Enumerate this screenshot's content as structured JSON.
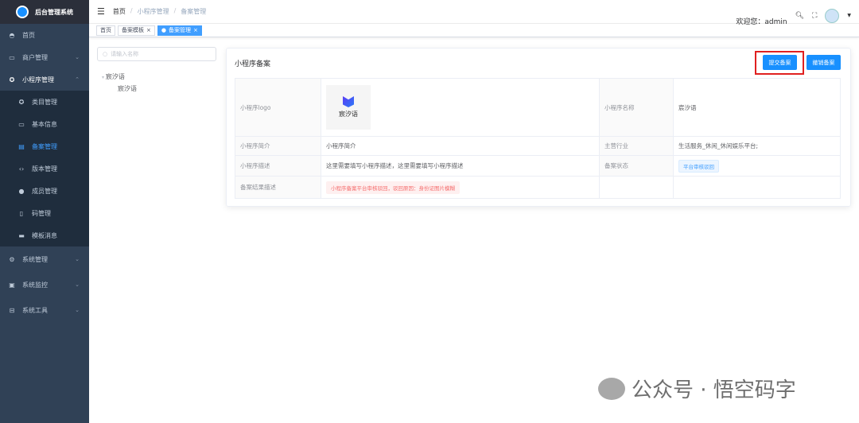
{
  "app": {
    "title": "后台管理系统"
  },
  "sidebar": {
    "items": [
      {
        "label": "首页",
        "icon": "dashboard-icon"
      },
      {
        "label": "商户管理",
        "icon": "merchant-icon"
      },
      {
        "label": "小程序管理",
        "icon": "miniprogram-icon",
        "children": [
          {
            "label": "类目管理"
          },
          {
            "label": "基本信息"
          },
          {
            "label": "备案管理",
            "active": true
          },
          {
            "label": "版本管理"
          },
          {
            "label": "成员管理"
          },
          {
            "label": "码管理"
          },
          {
            "label": "模板消息"
          }
        ]
      },
      {
        "label": "系统管理",
        "icon": "gear-icon"
      },
      {
        "label": "系统监控",
        "icon": "monitor-icon"
      },
      {
        "label": "系统工具",
        "icon": "toolbox-icon"
      }
    ]
  },
  "header": {
    "breadcrumb": [
      "首页",
      "小程序管理",
      "备案管理"
    ],
    "welcome": "欢迎您：admin"
  },
  "tabs": [
    {
      "label": "首页"
    },
    {
      "label": "备案模板"
    },
    {
      "label": "备案管理",
      "active": true
    }
  ],
  "tree": {
    "placeholder": "请输入名称",
    "root": "宸汐语",
    "child": "宸汐语"
  },
  "card": {
    "title": "小程序备案",
    "submit": "提交备案",
    "revoke": "撤销备案",
    "labels": {
      "logo": "小程序logo",
      "name": "小程序名称",
      "intro": "小程序简介",
      "industry": "主营行业",
      "desc": "小程序描述",
      "status": "备案状态",
      "result": "备案结果描述"
    },
    "values": {
      "logo_text": "宸汐语",
      "name": "宸汐语",
      "intro": "小程序简介",
      "industry": "生活服务_休闲_休闲娱乐平台;",
      "desc": "这里需要填写小程序描述，这里需要填写小程序描述",
      "status": "平台审核驳回",
      "result": "小程序备案平台审核驳回，驳回原因：身份证图片模糊"
    }
  },
  "watermark": "公众号 · 悟空码字",
  "colors": {
    "primary": "#1890ff",
    "sidebar": "#304156",
    "highlight": "#e02020"
  }
}
